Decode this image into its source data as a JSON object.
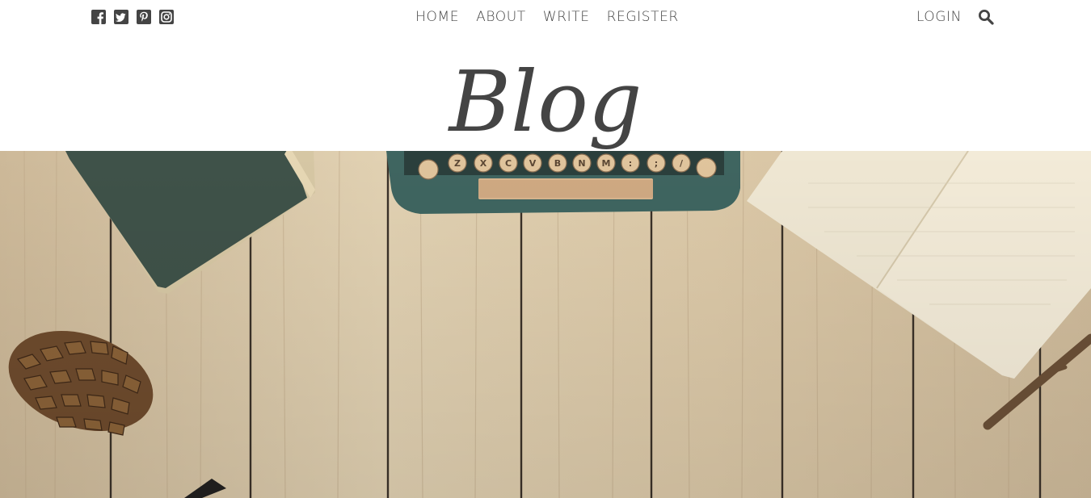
{
  "social": {
    "icons": [
      "facebook-icon",
      "twitter-icon",
      "pinterest-icon",
      "instagram-icon"
    ]
  },
  "nav": {
    "items": [
      "HOME",
      "ABOUT",
      "WRITE",
      "REGISTER"
    ]
  },
  "account": {
    "login_label": "LOGIN",
    "search_icon": "search-icon"
  },
  "header": {
    "title": "Blog"
  },
  "hero": {
    "keyboard_keys": [
      "Z",
      "X",
      "C",
      "V",
      "B",
      "N",
      "M",
      ":",
      ";",
      "/"
    ]
  },
  "colors": {
    "text": "#444444",
    "wood": "#d8c7a8",
    "book": "#3f5249",
    "typewriter": "#3f6560"
  }
}
